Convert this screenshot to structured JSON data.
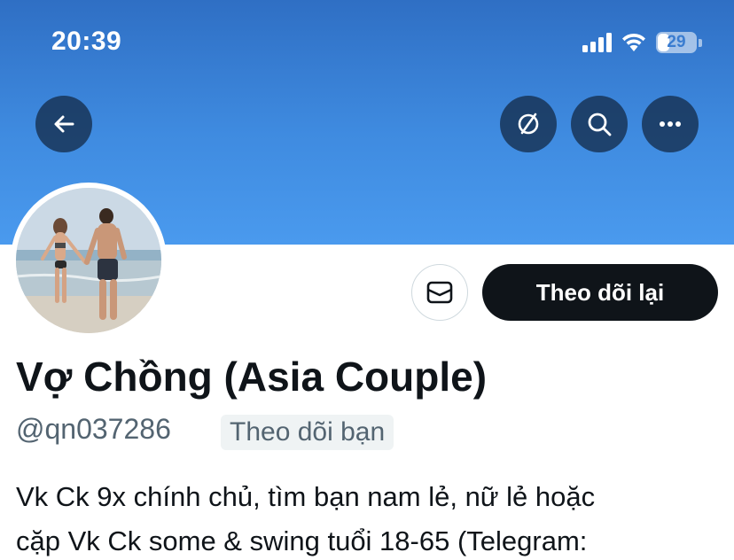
{
  "status_bar": {
    "time": "20:39",
    "battery": "29"
  },
  "header": {
    "back_icon": "arrow-left-icon",
    "actions": [
      {
        "name": "lists-icon"
      },
      {
        "name": "search-icon"
      },
      {
        "name": "more-icon"
      }
    ]
  },
  "profile": {
    "display_name": "Vợ Chồng (Asia Couple)",
    "handle": "@qn037286",
    "follows_you_label": "Theo dõi bạn",
    "follow_back_label": "Theo dõi lại",
    "bio_lines": [
      "Vk Ck 9x chính chủ, tìm bạn nam lẻ, nữ lẻ hoặc",
      "cặp Vk Ck some & swing tuổi 18-65 (Telegram:"
    ]
  },
  "colors": {
    "banner": "#3f8be0",
    "primary_button": "#0f1419",
    "secondary_text": "#536471"
  }
}
